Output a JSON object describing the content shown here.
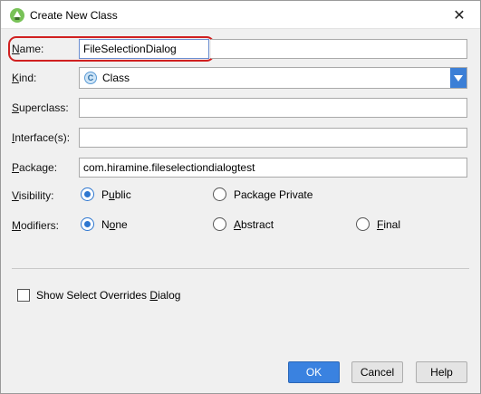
{
  "window": {
    "title": "Create New Class",
    "close_glyph": "✕"
  },
  "form": {
    "name": {
      "label_u": "N",
      "label_rest": "ame:",
      "value": "FileSelectionDialog"
    },
    "kind": {
      "label_u": "K",
      "label_rest": "ind:",
      "badge": "C",
      "value": "Class"
    },
    "superclass": {
      "label_u": "S",
      "label_rest": "uperclass:",
      "value": ""
    },
    "interfaces": {
      "label_u": "I",
      "label_rest": "nterface(s):",
      "value": ""
    },
    "package": {
      "label_u": "P",
      "label_rest": "ackage:",
      "value": "com.hiramine.fileselectiondialogtest"
    },
    "visibility": {
      "label_u": "V",
      "label_rest": "isibility:",
      "public": {
        "pre": "P",
        "u": "u",
        "post": "blic",
        "selected": true
      },
      "package_private": {
        "pre": "Package Private",
        "u": "",
        "post": "",
        "selected": false
      }
    },
    "modifiers": {
      "label_u": "M",
      "label_rest": "odifiers:",
      "none": {
        "pre": "N",
        "u": "o",
        "post": "ne",
        "selected": true
      },
      "abstract": {
        "pre": "",
        "u": "A",
        "post": "bstract",
        "selected": false
      },
      "final": {
        "pre": "",
        "u": "F",
        "post": "inal",
        "selected": false
      }
    },
    "show_overrides": {
      "pre": "Show Select Overrides ",
      "u": "D",
      "post": "ialog",
      "checked": false
    }
  },
  "buttons": {
    "ok": "OK",
    "cancel": "Cancel",
    "help": "Help"
  },
  "colors": {
    "accent": "#3a82e0",
    "highlight": "#d02020",
    "android_green": "#78c257"
  },
  "icons": {
    "app": "android-studio-icon",
    "kind": "class-badge-icon",
    "dropdown": "chevron-down-icon"
  }
}
